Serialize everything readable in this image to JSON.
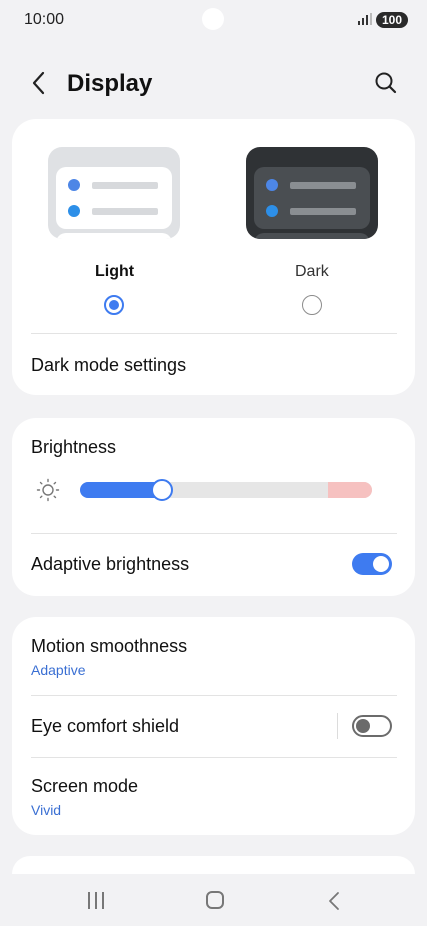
{
  "status": {
    "time": "10:00",
    "battery": "100"
  },
  "header": {
    "title": "Display"
  },
  "theme": {
    "light_label": "Light",
    "dark_label": "Dark",
    "selected": "Light",
    "dark_mode_settings": "Dark mode settings"
  },
  "brightness": {
    "title": "Brightness",
    "level": 0.28,
    "adaptive_label": "Adaptive brightness",
    "adaptive_on": true
  },
  "display": {
    "motion_label": "Motion smoothness",
    "motion_value": "Adaptive",
    "eye_comfort_label": "Eye comfort shield",
    "eye_comfort_on": false,
    "screen_mode_label": "Screen mode",
    "screen_mode_value": "Vivid"
  },
  "colors": {
    "accent": "#3e7bf0",
    "link": "#3a6fd3",
    "preview_dot_1": "#4d86e6",
    "preview_dot_2": "#2d8fe8"
  },
  "icons": [
    "back-arrow-icon",
    "search-icon",
    "sun-icon",
    "recent-apps-icon",
    "home-icon",
    "nav-back-icon"
  ]
}
